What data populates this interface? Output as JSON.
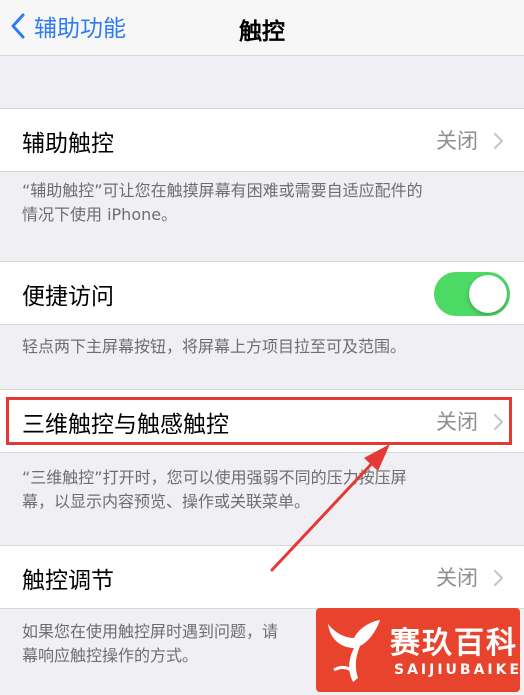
{
  "nav": {
    "back_label": "辅助功能",
    "title": "触控"
  },
  "assistive_touch": {
    "label": "辅助触控",
    "value": "关闭",
    "footer_line1": "“辅助触控”可让您在触摸屏幕有困难或需要自适应配件的",
    "footer_line2": "情况下使用 iPhone。"
  },
  "reachability": {
    "label": "便捷访问",
    "toggle_on": true,
    "footer": "轻点两下主屏幕按钮，将屏幕上方项目拉至可及范围。"
  },
  "touch_3d": {
    "label": "三维触控与触感触控",
    "value": "关闭",
    "footer_line1": "“三维触控”打开时，您可以使用强弱不同的压力按压屏",
    "footer_line2": "幕，以显示内容预览、操作或关联菜单。"
  },
  "touch_accommodations": {
    "label": "触控调节",
    "value": "关闭",
    "footer_line1": "如果您在使用触控屏时遇到问题，请",
    "footer_line2": "幕响应触控操作的方式。"
  },
  "watermark": {
    "title": "赛玖百科",
    "subtitle": "SAIJIUBAIKE"
  },
  "colors": {
    "accent": "#2f7bf5",
    "toggle_on": "#4cd964",
    "highlight": "#e53935",
    "watermark": "#e8432c"
  },
  "icons": [
    "chevron-left-icon",
    "chevron-right-icon",
    "arrow-annotation",
    "whale-tail-logo"
  ]
}
